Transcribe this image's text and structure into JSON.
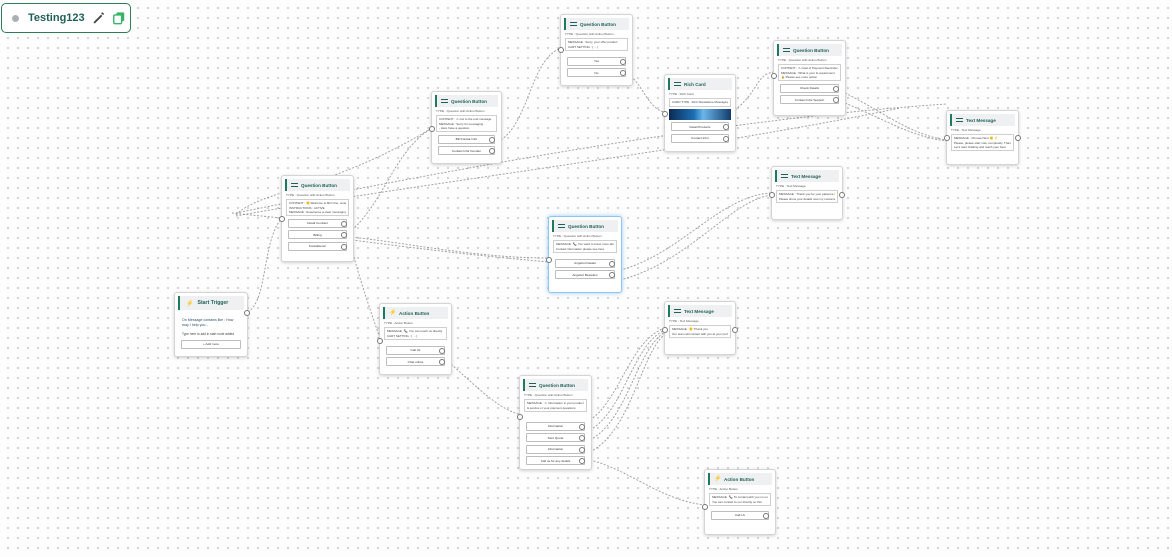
{
  "flow": {
    "name": "Testing123"
  },
  "icons": {
    "edit": "pencil-icon",
    "copy": "copy-icon",
    "status": "status-dot-icon",
    "question": "question-button-icon",
    "action": "lightning-icon",
    "message": "message-icon",
    "card": "card-icon",
    "trigger": "trigger-icon"
  },
  "colors": {
    "accent": "#1d7a5f",
    "title": "#1f5f58",
    "edge": "#9a9a9a",
    "selected": "#8ec5f2"
  },
  "nodes": {
    "start": {
      "title": "Start Trigger",
      "text": "On Message contains like : How may I help you...",
      "sub": "Type here to add in start node added",
      "option": "+ Add more"
    },
    "qb_main": {
      "title": "Question Button",
      "type_line": "TYPE : Question with Action Button",
      "rows": [
        "CONTENT : 🙂 Welcome to Bot One, understand your ...",
        "INSTRUCTIONS : ACTIVE",
        "MESSAGE : Experience a clear messaging"
      ],
      "options": [
        "Detail Contract",
        "Billing",
        "Kontaktieren"
      ]
    },
    "qb_top1": {
      "title": "Question Button",
      "type_line": "TYPE : Question with Action Button",
      "rows": [
        "CONTENT : ⚠ Cut to the end message",
        "MESSAGE : Sorry for messaging",
        "- Here have a question"
      ],
      "options": [
        "Bill Kontak Infor",
        "Contact Infor Kunden"
      ]
    },
    "qb_top2": {
      "title": "Question Button",
      "type_line": "TYPE : Question with Action Button",
      "rows": [
        "MESSAGE : Sorry, your offer product",
        "CART SETTING : [ ... ]"
      ],
      "options": [
        "Yes",
        "No"
      ]
    },
    "rich_card": {
      "title": "Rich Card",
      "type_line": "TYPE : Rich Card",
      "rows": [
        "CARD TYPE : Rich Standalone Messaging"
      ],
      "options": [
        "Detail Products",
        "Contact Infor"
      ]
    },
    "qb_top3": {
      "title": "Question Button",
      "type_line": "TYPE : Question with Action Button",
      "rows": [
        "CONTENT : ⚠ Goal of Payment Reminder",
        "MESSAGE : What is your & requirement",
        "🔒 Please see more option"
      ],
      "options": [
        "Check Details",
        "Contact Infor Support"
      ]
    },
    "tm_right": {
      "title": "Text Message",
      "type_line": "TYPE : Text Message",
      "rows": [
        "MESSAGE : Choose Next 🙂 ⚡",
        "Please, please start now, completely. Thanks and say",
        "Let's start chatting and reach your best"
      ]
    },
    "tm_mid": {
      "title": "Text Message",
      "type_line": "TYPE : Text Message",
      "rows": [
        "MESSAGE : Thank you for your patience 🙂",
        "Please show your details now my customer will contact you shortly"
      ]
    },
    "qb_sel": {
      "title": "Question Button",
      "type_line": "TYPE : Question with Action Button",
      "rows": [
        "MESSAGE : 📞 You want to know more about billing",
        "Contact information please see here"
      ],
      "options": [
        "Angebot Details",
        "Angebot Bestellen"
      ]
    },
    "ab_mid": {
      "title": "Action Button",
      "type_line": "TYPE : Action Button",
      "rows": [
        "MESSAGE : 📞 You can reach us directly",
        "CART SETTING : [ ... ]"
      ],
      "options": [
        "Call Us",
        "Chat online"
      ]
    },
    "tm_low": {
      "title": "Text Message",
      "type_line": "TYPE : Text Message",
      "rows": [
        "MESSAGE : 🙂 Thank you",
        "",
        "Our team will contact with you at your preferred time"
      ]
    },
    "qb_low": {
      "title": "Question Button",
      "type_line": "TYPE : Question with Action Button",
      "rows": [
        "MESSAGE : ⚠ Information in your product & service or your payment questions"
      ],
      "options": [
        "Information",
        "Sent Quote",
        "Information",
        "Call us for any details"
      ]
    },
    "ab_bottom": {
      "title": "Action Button",
      "type_line": "TYPE : Action Button",
      "rows": [
        "MESSAGE : 📞 To contact with you on our agent now",
        "You can contact to our directly on this"
      ],
      "options": [
        "Call Us"
      ]
    }
  }
}
